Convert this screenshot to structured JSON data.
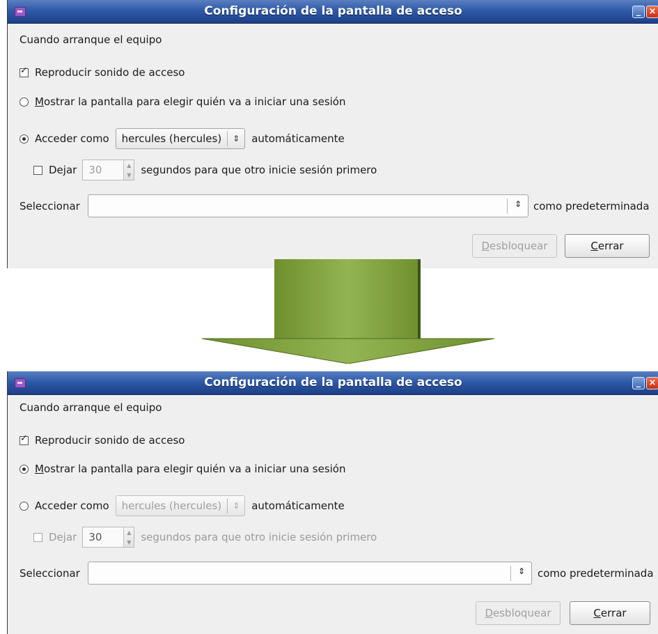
{
  "window_title": "Configuración de la pantalla de acceso",
  "heading": "Cuando arranque el equipo",
  "play_sound_label": "Reproducir sonido de acceso",
  "show_screen_label_rest": "ostrar la pantalla para elegir quién va a iniciar una sesión",
  "show_screen_mnemonic": "M",
  "login_as_label": "Acceder como",
  "user_combo_value": "hercules (hercules)",
  "automatically_label": "automáticamente",
  "delay_label": "Dejar",
  "delay_value": "30",
  "delay_suffix": "segundos para que otro inicie sesión primero",
  "select_label": "Seleccionar",
  "default_suffix": "como predeterminada",
  "unlock_mnemonic": "D",
  "unlock_rest": "esbloquear",
  "close_mnemonic": "C",
  "close_rest": "errar",
  "colors": {
    "title_bar": "#2f5aa8",
    "arrow_green": "#7f9f3c"
  },
  "before": {
    "play_sound": true,
    "show_screen": false,
    "login_as": true,
    "delay": false
  },
  "after": {
    "play_sound": true,
    "show_screen": true,
    "login_as": false,
    "delay": false
  }
}
